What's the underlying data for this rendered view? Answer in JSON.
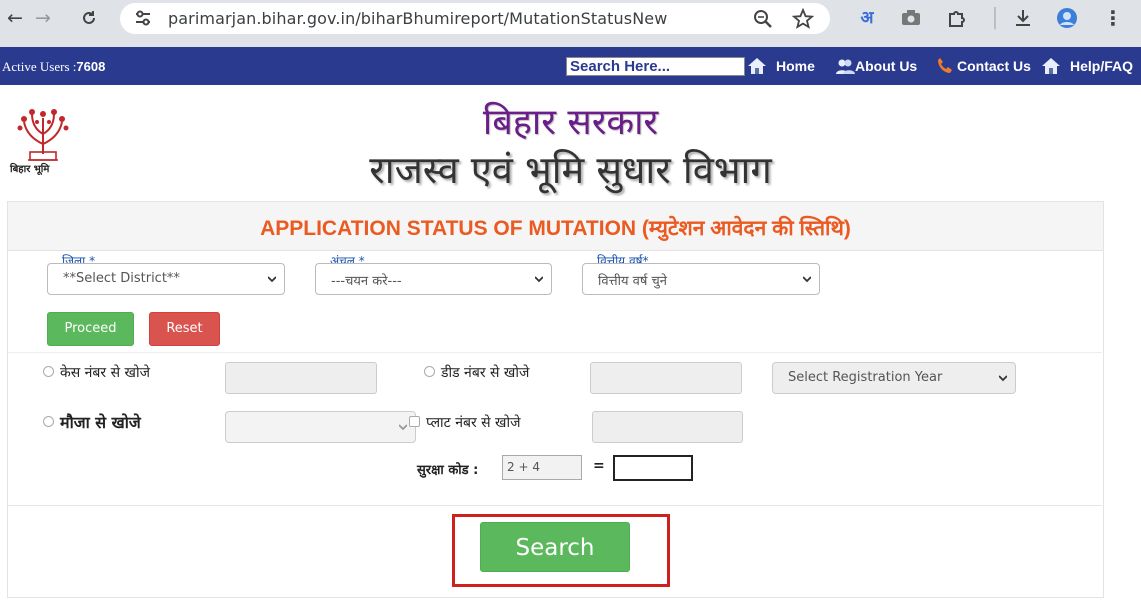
{
  "browser": {
    "url": "parimarjan.bihar.gov.in/biharBhumireport/MutationStatusNew",
    "ext_letter": "अ",
    "icons": [
      "back-icon",
      "forward-icon",
      "reload-icon",
      "site-info-icon",
      "zoom-icon",
      "bookmark-star-icon",
      "translate-icon",
      "camera-icon",
      "extensions-icon",
      "download-icon",
      "profile-icon",
      "menu-icon"
    ]
  },
  "topbar": {
    "active_users_label": "Active Users :",
    "active_users_count": "7608",
    "search_placeholder": "Search Here...",
    "links": {
      "home": "Home",
      "about": "About Us",
      "contact": "Contact Us",
      "help": "Help/FAQ"
    }
  },
  "header": {
    "line1": "बिहार सरकार",
    "line2": "राजस्व एवं भूमि सुधार विभाग",
    "logo_caption": "बिहार भूमि"
  },
  "form": {
    "title": "APPLICATION STATUS OF MUTATION (म्युटेशन आवेदन की स्तिथि)",
    "district": {
      "label": "जिला",
      "required": "*",
      "value": "**Select District**"
    },
    "circle": {
      "label": "अंचल",
      "required": "*",
      "value": "---चयन करे---"
    },
    "fin_year": {
      "label": "वित्तीय वर्ष",
      "required": "*",
      "value": "वित्तीय वर्ष चुने"
    },
    "proceed_label": "Proceed",
    "reset_label": "Reset",
    "search_case": "केस नंबर से खोजे",
    "search_deed": "डीड नंबर से खोजे",
    "registration_year": "Select Registration Year",
    "search_mauja": "मौजा से खोजे",
    "search_plot": "प्लाट नंबर से खोजे",
    "captcha_label": "सुरक्षा कोड :",
    "captcha_question": "2 + 4",
    "captcha_equals": "=",
    "search_button": "Search"
  },
  "colors": {
    "topbar_bg": "#2a3a8f",
    "title_orange": "#ea5a21",
    "header_purple": "#6a1e8a",
    "button_green": "#5cb85c",
    "button_red": "#d9534f",
    "highlight_red": "#d0201d"
  }
}
